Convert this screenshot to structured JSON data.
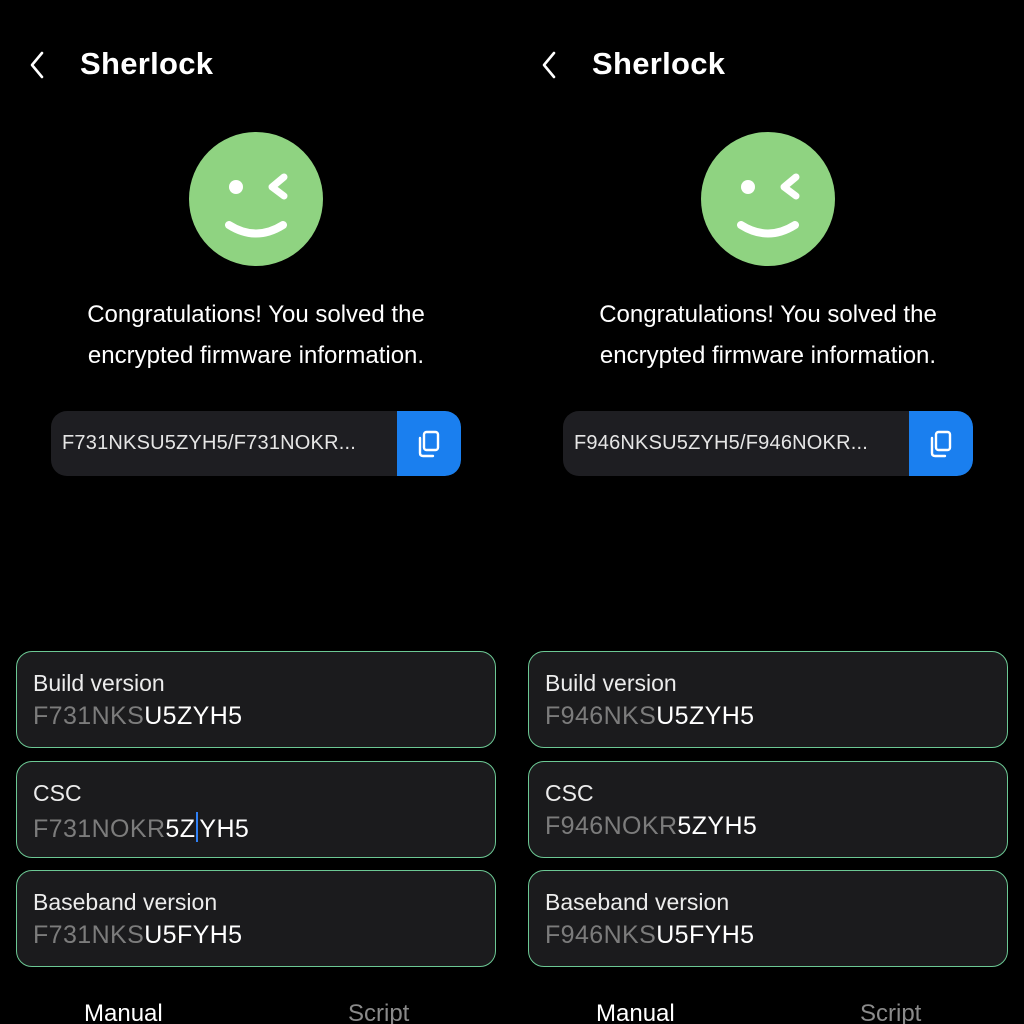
{
  "colors": {
    "background": "#000000",
    "smiley": "#8fd381",
    "copy_button": "#1a7fef",
    "field_border": "#6cc894",
    "field_background": "#1b1b1d",
    "caret": "#2f80f5"
  },
  "icons": {
    "back": "chevron-left-icon",
    "emoji": "winking-smiley-icon",
    "copy": "copy-icon"
  },
  "panels": [
    {
      "title": "Sherlock",
      "message_line1": "Congratulations! You solved the",
      "message_line2": "encrypted firmware information.",
      "firmware_code": "F731NKSU5ZYH5/F731NOKR...",
      "fields": [
        {
          "label": "Build version",
          "prefix": "F731NKS",
          "suffix": "U5ZYH5"
        },
        {
          "label": "CSC",
          "prefix": "F731NOKR",
          "suffix_before_caret": "5Z",
          "suffix_after_caret": "YH5"
        },
        {
          "label": "Baseband version",
          "prefix": "F731NKS",
          "suffix": "U5FYH5"
        }
      ],
      "tabs": [
        "Manual",
        "Script"
      ]
    },
    {
      "title": "Sherlock",
      "message_line1": "Congratulations! You solved the",
      "message_line2": "encrypted firmware information.",
      "firmware_code": "F946NKSU5ZYH5/F946NOKR...",
      "fields": [
        {
          "label": "Build version",
          "prefix": "F946NKS",
          "suffix": "U5ZYH5"
        },
        {
          "label": "CSC",
          "prefix": "F946NOKR",
          "suffix": "5ZYH5"
        },
        {
          "label": "Baseband version",
          "prefix": "F946NKS",
          "suffix": "U5FYH5"
        }
      ],
      "tabs": [
        "Manual",
        "Script"
      ]
    }
  ]
}
